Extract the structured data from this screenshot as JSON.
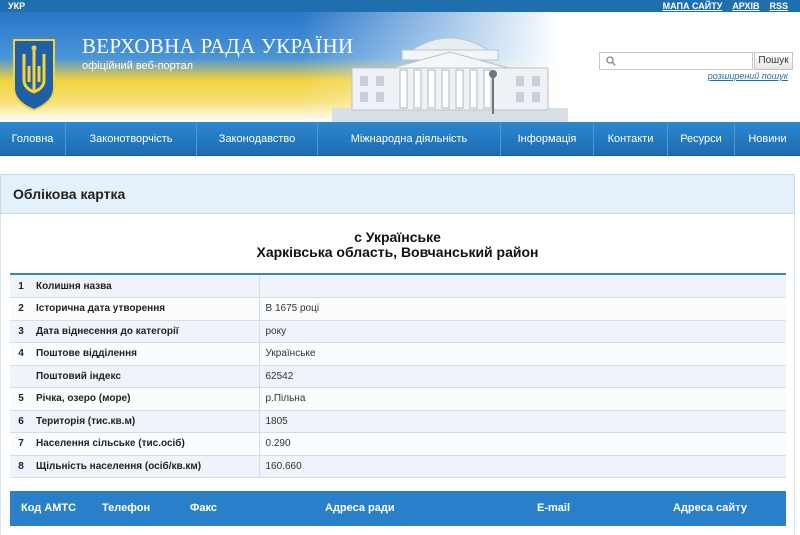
{
  "topbar": {
    "lang": "УКР",
    "links": [
      "МАПА САЙТУ",
      "АРХІВ",
      "RSS"
    ]
  },
  "header": {
    "title": "ВЕРХОВНА РАДА УКРАЇНИ",
    "subtitle": "офіційний веб-портал",
    "search_placeholder": "",
    "search_button": "Пошук",
    "advanced_search": "розширений пошук"
  },
  "nav": [
    "Головна",
    "Законотворчість",
    "Законодавство",
    "Міжнародна діяльність",
    "Інформація",
    "Контакти",
    "Ресурси",
    "Новини"
  ],
  "card": {
    "heading": "Облікова картка",
    "settlement": "с Українське",
    "region": "Харківська область, Вовчанський район",
    "rows": [
      {
        "num": "1",
        "label": "Колишня назва",
        "value": ""
      },
      {
        "num": "2",
        "label": "Історична дата утворення",
        "value": "В 1675 році"
      },
      {
        "num": "3",
        "label": "Дата віднесення до категорії",
        "value": "року"
      },
      {
        "num": "4",
        "label": "Поштове відділення",
        "value": "Українське"
      },
      {
        "num": "",
        "label": "Поштовий індекс",
        "value": "62542"
      },
      {
        "num": "5",
        "label": "Річка, озеро (море)",
        "value": "р.Пільна"
      },
      {
        "num": "6",
        "label": "Територія (тис.кв.м)",
        "value": "1805"
      },
      {
        "num": "7",
        "label": "Населення сільське (тис.осіб)",
        "value": "0.290"
      },
      {
        "num": "8",
        "label": "Щільність населення (осіб/кв.км)",
        "value": "160.660"
      }
    ]
  },
  "contacts": {
    "headers": [
      "Код АМТС",
      "Телефон",
      "Факс",
      "Адреса ради",
      "E-mail",
      "Адреса сайту"
    ]
  },
  "colors": {
    "primary_blue": "#1f6fae",
    "nav_blue": "#2a80c8",
    "flag_yellow": "#f3d23c"
  }
}
